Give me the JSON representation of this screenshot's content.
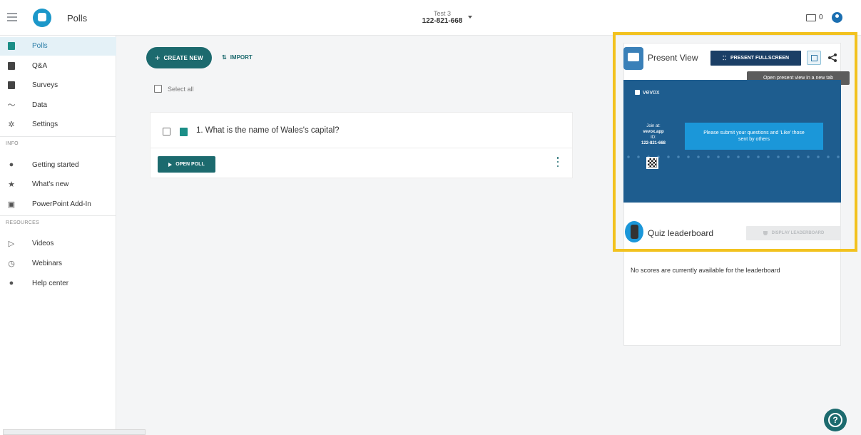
{
  "header": {
    "app_title": "Polls",
    "event_name": "Test 3",
    "event_code": "122-821-668",
    "screens_count": "0"
  },
  "sidebar": {
    "items": [
      {
        "label": "Polls",
        "icon": "polls-icon"
      },
      {
        "label": "Q&A",
        "icon": "qa-icon"
      },
      {
        "label": "Surveys",
        "icon": "surveys-icon"
      },
      {
        "label": "Data",
        "icon": "data-chart-icon"
      },
      {
        "label": "Settings",
        "icon": "gear-icon"
      }
    ],
    "info_label": "INFO",
    "info_items": [
      {
        "label": "Getting started",
        "icon": "question-circle-icon"
      },
      {
        "label": "What's new",
        "icon": "star-icon"
      },
      {
        "label": "PowerPoint Add-In",
        "icon": "powerpoint-icon"
      }
    ],
    "resources_label": "RESOURCES",
    "resources_items": [
      {
        "label": "Videos",
        "icon": "play-video-icon"
      },
      {
        "label": "Webinars",
        "icon": "clock-icon"
      },
      {
        "label": "Help center",
        "icon": "help-circle-icon"
      }
    ]
  },
  "main": {
    "create_new": "CREATE NEW",
    "import": "IMPORT",
    "select_all": "Select all",
    "poll": {
      "title": "1. What is the name of Wales's capital?",
      "open_label": "OPEN POLL"
    }
  },
  "panel": {
    "present_view_title": "Present View",
    "present_fullscreen": "PRESENT FULLSCREEN",
    "tooltip": "Open present view in a new tab",
    "preview": {
      "brand": "vevox",
      "join_at": "Join at:",
      "join_url": "vevox.app",
      "id_label": "ID:",
      "id_value": "122-821-668",
      "message": "Please submit your questions and 'Like' those sent by others"
    },
    "quiz_title": "Quiz leaderboard",
    "display_leaderboard": "DISPLAY LEADERBOARD",
    "no_scores": "No scores are currently available for the leaderboard"
  },
  "accent_colors": {
    "teal": "#1c6a6e",
    "navy": "#1b3f66",
    "highlight": "#f2c21f",
    "preview_bg": "#1e5d8f"
  }
}
